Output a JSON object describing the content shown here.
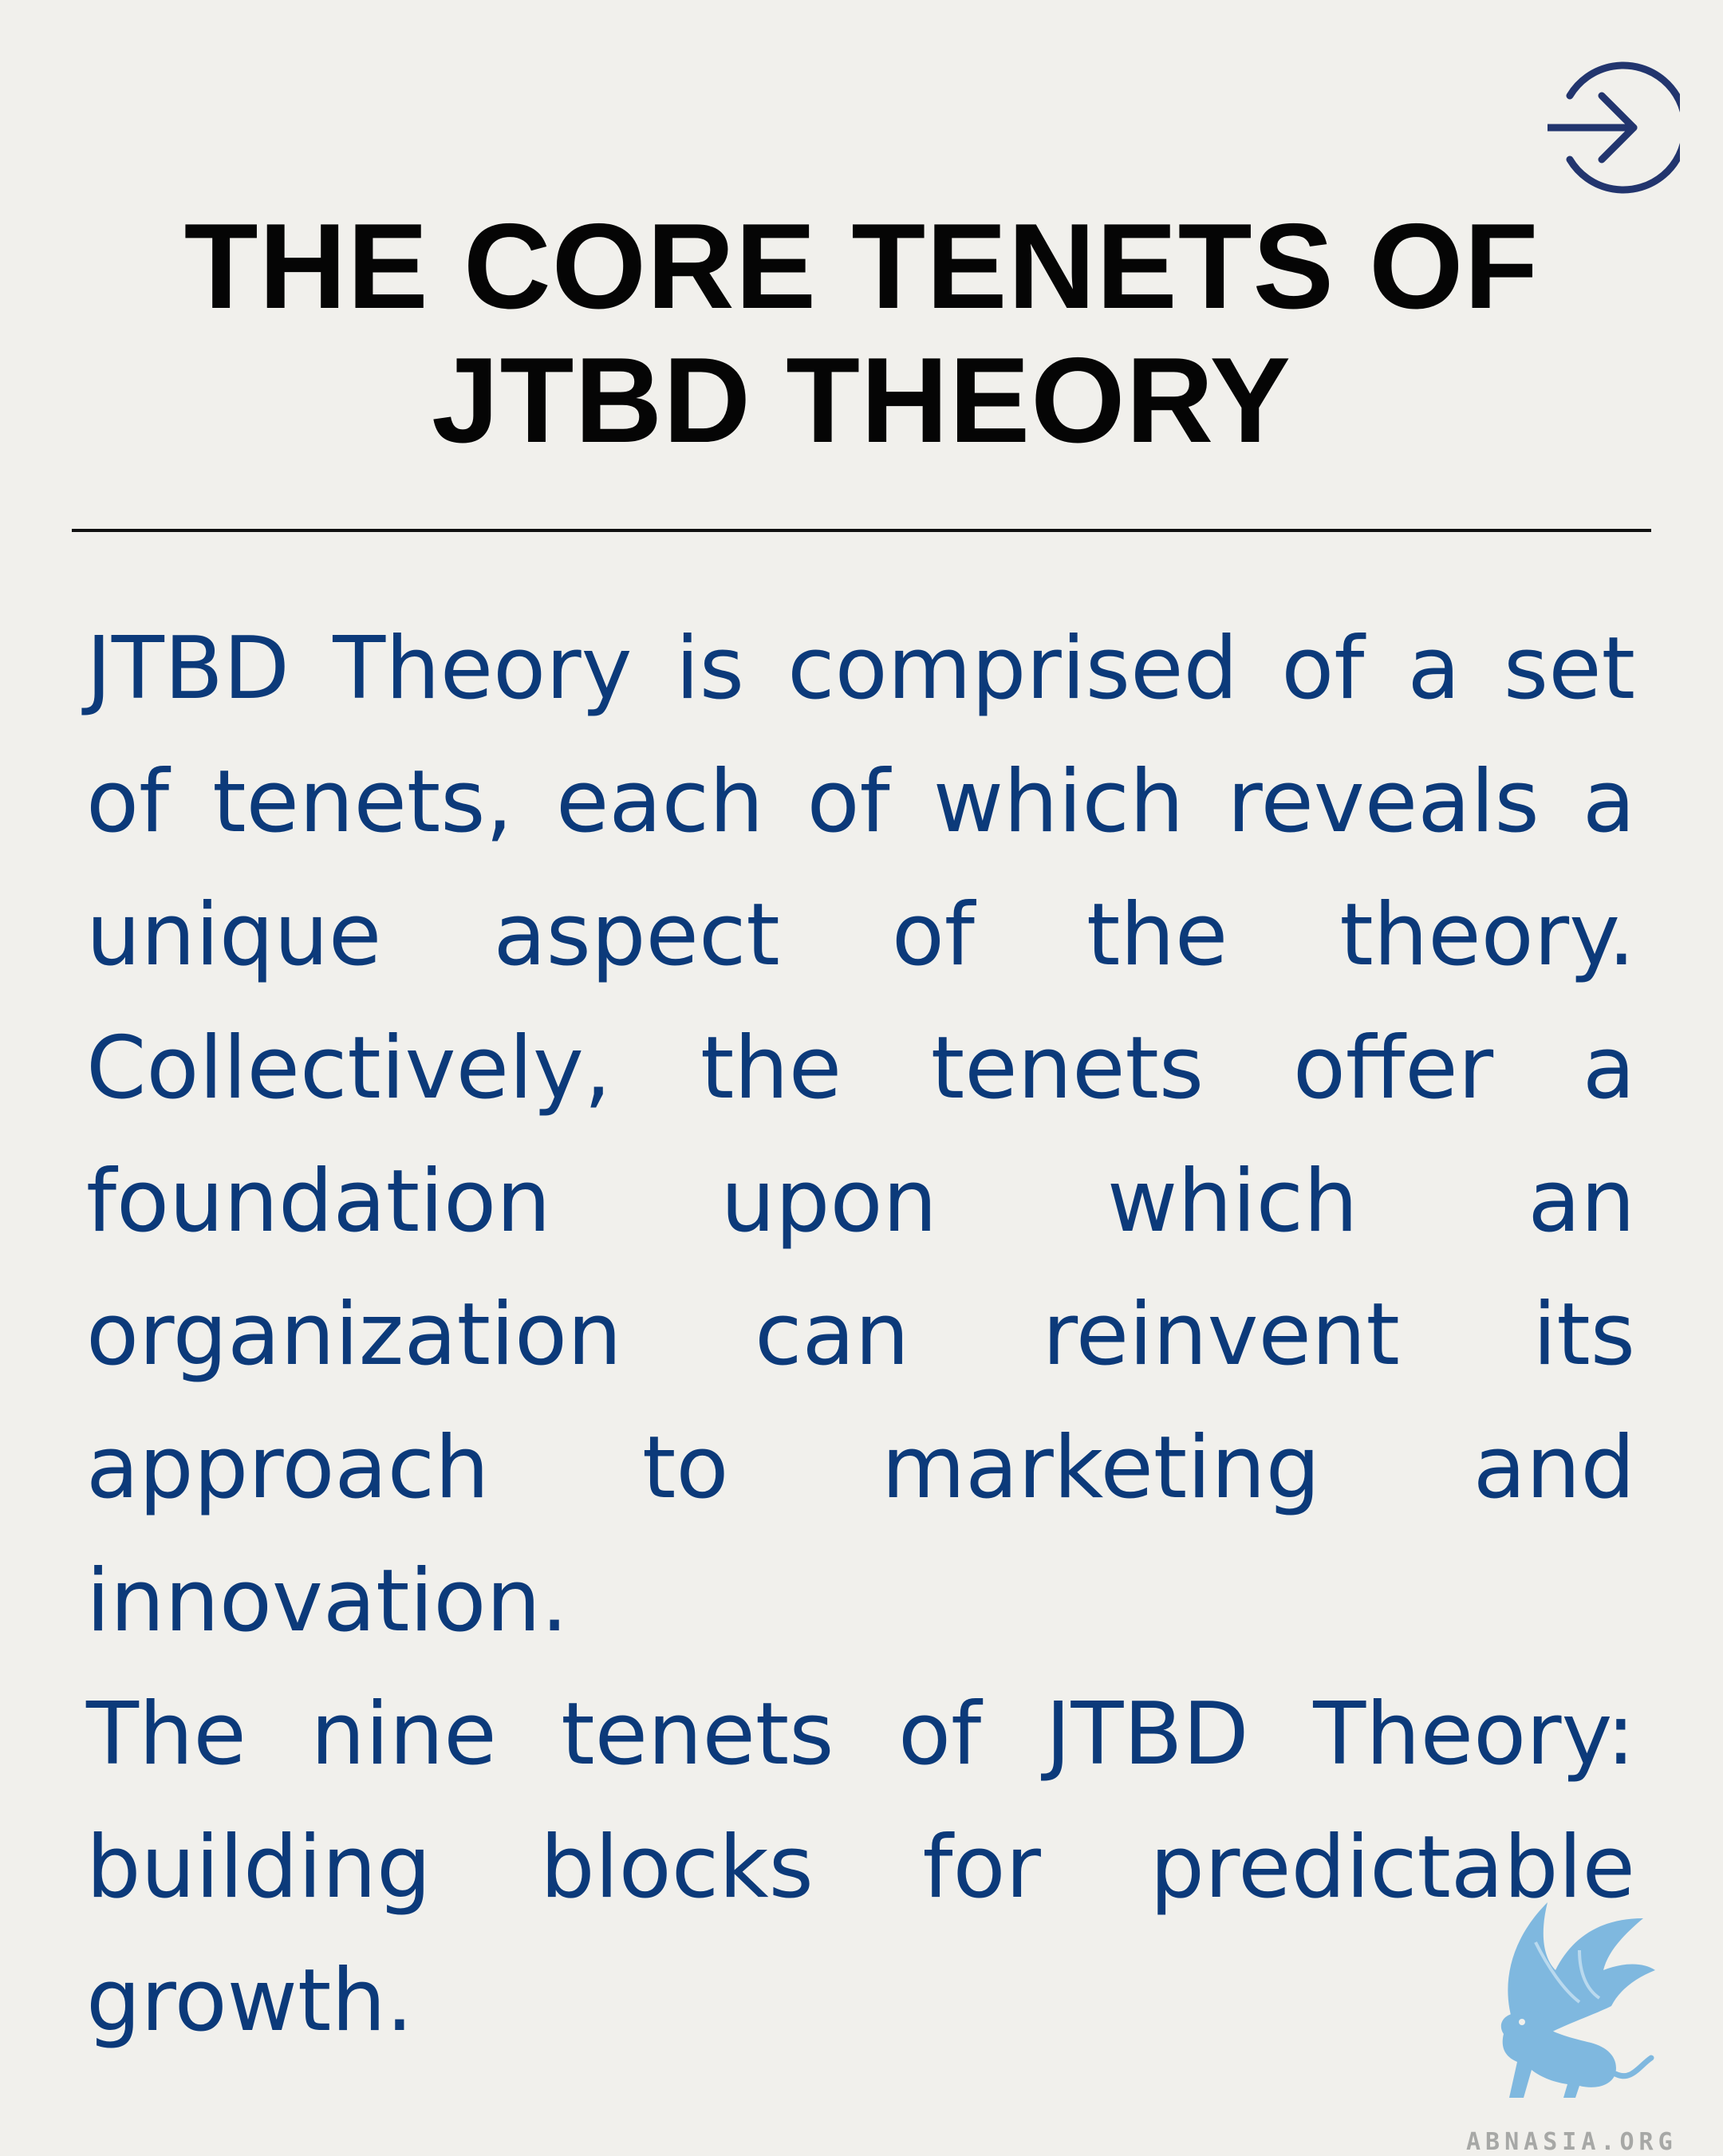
{
  "header": {
    "next_icon": "arrow-right-circle-icon",
    "title_line1": "THE CORE TENETS OF",
    "title_line2": "JTBD THEORY"
  },
  "body": {
    "paragraph1": "JTBD Theory is comprised of a set of tenets, each of which reveals a unique aspect of the theory. Collectively, the tenets offer a foundation upon which an organization can reinvent its approach to marketing and innovation.",
    "paragraph2": "The nine tenets of JTBD Theory: building blocks for predictable growth."
  },
  "branding": {
    "logo_icon": "griffin-logo-icon",
    "logo_text": "ABNASIA.ORG"
  },
  "colors": {
    "background": "#f1f0ec",
    "title": "#050505",
    "body_text": "#0c3a7a",
    "arrow": "#22356e",
    "logo": "#7fb8df"
  }
}
